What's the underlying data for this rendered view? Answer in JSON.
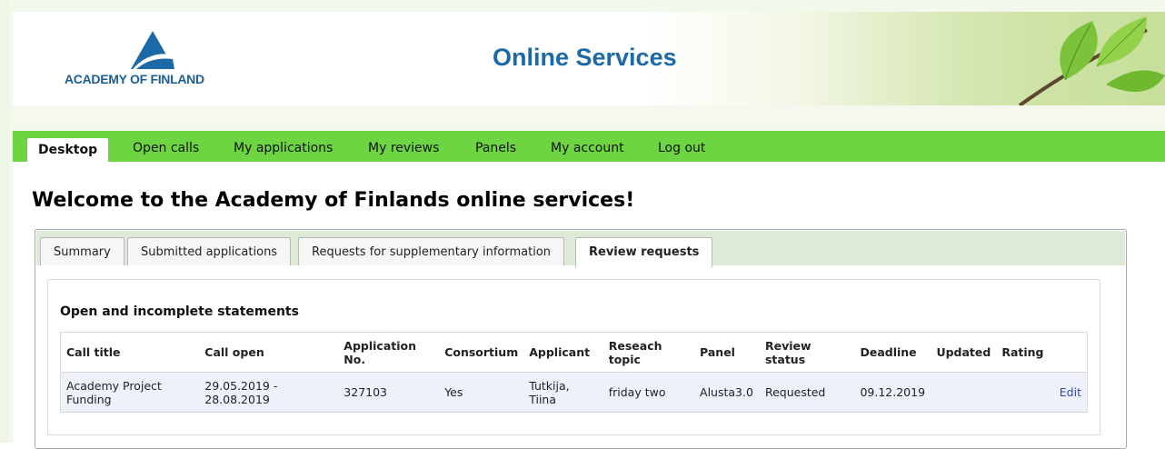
{
  "header": {
    "logo_text": "ACADEMY OF FINLAND",
    "title": "Online Services"
  },
  "nav": [
    {
      "label": "Desktop",
      "active": true
    },
    {
      "label": "Open calls"
    },
    {
      "label": "My applications"
    },
    {
      "label": "My reviews"
    },
    {
      "label": "Panels"
    },
    {
      "label": "My account"
    },
    {
      "label": "Log out"
    }
  ],
  "welcome": "Welcome to the Academy of Finlands online services!",
  "tabs": [
    {
      "label": "Summary"
    },
    {
      "label": "Submitted applications"
    },
    {
      "label": "Requests for supplementary information"
    },
    {
      "label": "Review requests",
      "active": true
    }
  ],
  "section_title": "Open and incomplete statements",
  "table": {
    "headers": [
      "Call title",
      "Call open",
      "Application No.",
      "Consortium",
      "Applicant",
      "Reseach topic",
      "Panel",
      "Review status",
      "Deadline",
      "Updated",
      "Rating"
    ],
    "rows": [
      {
        "call_title": "Academy Project Funding",
        "call_open": "29.05.2019 - 28.08.2019",
        "application_no": "327103",
        "consortium": "Yes",
        "applicant": "Tutkija, Tiina",
        "research_topic": "friday two",
        "panel": "Alusta3.0",
        "review_status": "Requested",
        "deadline": "09.12.2019",
        "updated": "",
        "rating": "",
        "action": "Edit"
      }
    ]
  },
  "colors": {
    "nav_green": "#6dd541",
    "brand_blue": "#1b69a6",
    "tabs_bar": "#ddebd6",
    "row_bg": "#eef1fa",
    "link": "#2a45c9"
  }
}
